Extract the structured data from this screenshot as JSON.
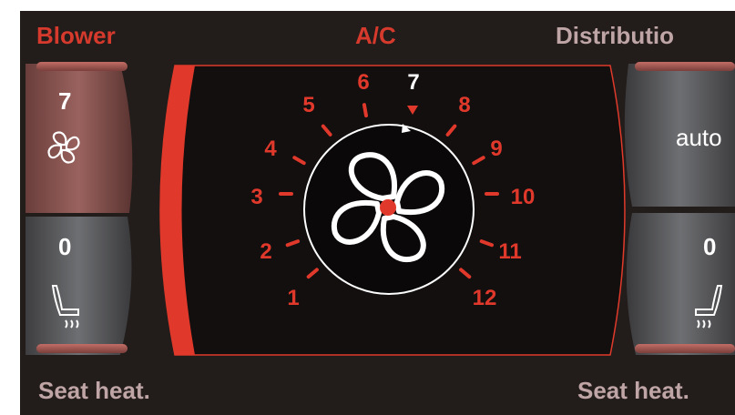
{
  "header": {
    "blower": "Blower",
    "ac": "A/C",
    "distribution": "Distributio"
  },
  "left_panel": {
    "blower_value": "7",
    "blower_icon": "fan-icon",
    "seat_heat_value": "0",
    "seat_heat_icon": "seat-heat-icon"
  },
  "right_panel": {
    "distribution_value": "auto",
    "seat_heat_value": "0",
    "seat_heat_icon": "seat-heat-icon"
  },
  "dial": {
    "labels": [
      "1",
      "2",
      "3",
      "4",
      "5",
      "6",
      "7",
      "8",
      "9",
      "10",
      "11",
      "12"
    ],
    "selected": "7",
    "center_icon": "fan-icon"
  },
  "footer": {
    "left": "Seat heat.",
    "right": "Seat heat."
  },
  "colors": {
    "accent_red": "#e0392b",
    "header_text": "#d63a2c",
    "footer_text": "#bfa5a5",
    "background": "#221c1b",
    "active_mauve": "#8f5a56"
  }
}
